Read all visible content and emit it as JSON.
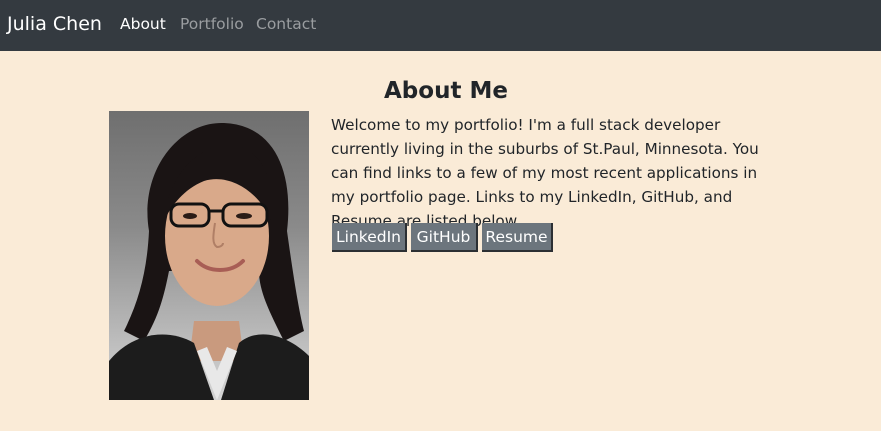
{
  "navbar": {
    "brand": "Julia Chen",
    "links": [
      {
        "label": "About",
        "active": true
      },
      {
        "label": "Portfolio",
        "active": false
      },
      {
        "label": "Contact",
        "active": false
      }
    ]
  },
  "about": {
    "heading": "About Me",
    "bio": "Welcome to my portfolio! I'm a full stack developer currently living in the suburbs of St.Paul, Minnesota. You can find links to a few of my most recent applications in my portfolio page. Links to my LinkedIn, GitHub, and Resume are listed below.",
    "buttons": [
      {
        "label": "LinkedIn"
      },
      {
        "label": "GitHub"
      },
      {
        "label": "Resume"
      }
    ]
  },
  "colors": {
    "page_background": "#faebd7",
    "navbar_background": "#343a40",
    "button_background": "#6c757d"
  }
}
